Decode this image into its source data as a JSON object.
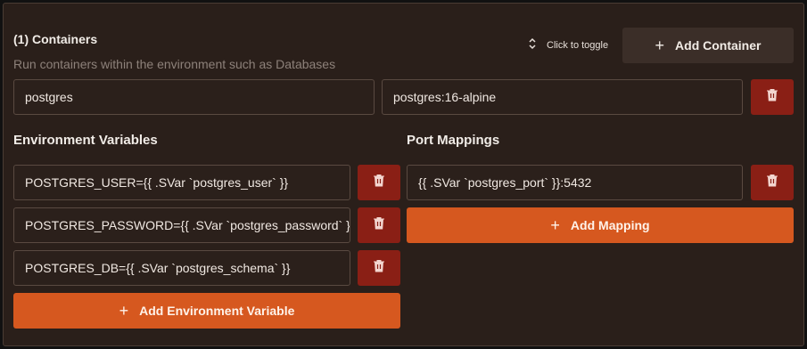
{
  "header": {
    "title": "(1) Containers",
    "subtitle": "Run containers within the environment such as Databases",
    "toggle_label": "Click to toggle",
    "add_container_label": "Add Container"
  },
  "container": {
    "name": "postgres",
    "image": "postgres:16-alpine"
  },
  "env": {
    "label": "Environment Variables",
    "items": [
      "POSTGRES_USER={{ .SVar `postgres_user` }}",
      "POSTGRES_PASSWORD={{ .SVar `postgres_password` }}",
      "POSTGRES_DB={{ .SVar `postgres_schema` }}"
    ],
    "add_label": "Add Environment Variable"
  },
  "ports": {
    "label": "Port Mappings",
    "items": [
      "{{ .SVar `postgres_port` }}:5432"
    ],
    "add_label": "Add Mapping"
  },
  "colors": {
    "accent": "#d6581f",
    "danger": "#8a1f15",
    "panel": "#2a1f1a"
  }
}
